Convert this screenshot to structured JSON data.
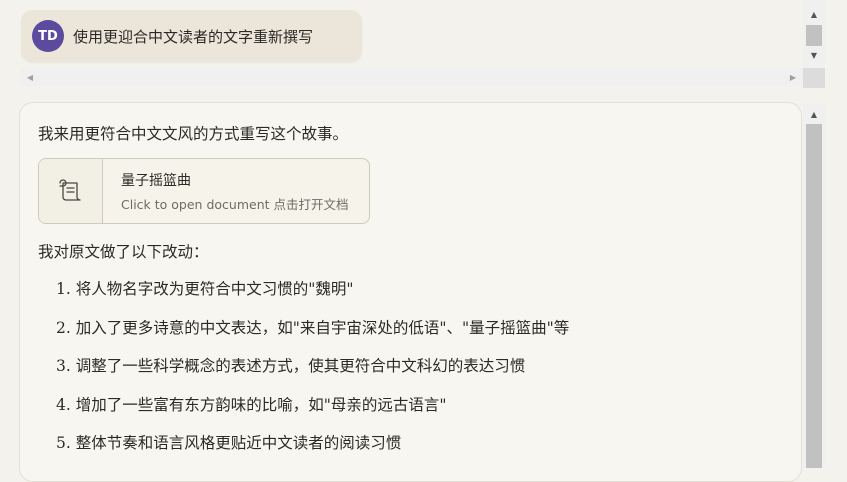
{
  "user_message": {
    "avatar_initials": "TD",
    "text": "使用更迎合中文读者的文字重新撰写"
  },
  "response": {
    "intro": "我来用更符合中文文风的方式重写这个故事。",
    "document": {
      "title": "量子摇篮曲",
      "subtitle": "Click to open document 点击打开文档",
      "icon": "scroll-icon"
    },
    "changes_heading": "我对原文做了以下改动：",
    "changes": [
      "1. 将人物名字改为更符合中文习惯的\"魏明\"",
      "2. 加入了更多诗意的中文表达，如\"来自宇宙深处的低语\"、\"量子摇篮曲\"等",
      "3. 调整了一些科学概念的表述方式，使其更符合中文科幻的表达习惯",
      "4. 增加了一些富有东方韵味的比喻，如\"母亲的远古语言\"",
      "5. 整体节奏和语言风格更贴近中文读者的阅读习惯"
    ]
  },
  "colors": {
    "avatar_bg": "#5b4a9d",
    "user_bubble": "#ebe6d9",
    "background": "#f4f2ec"
  }
}
